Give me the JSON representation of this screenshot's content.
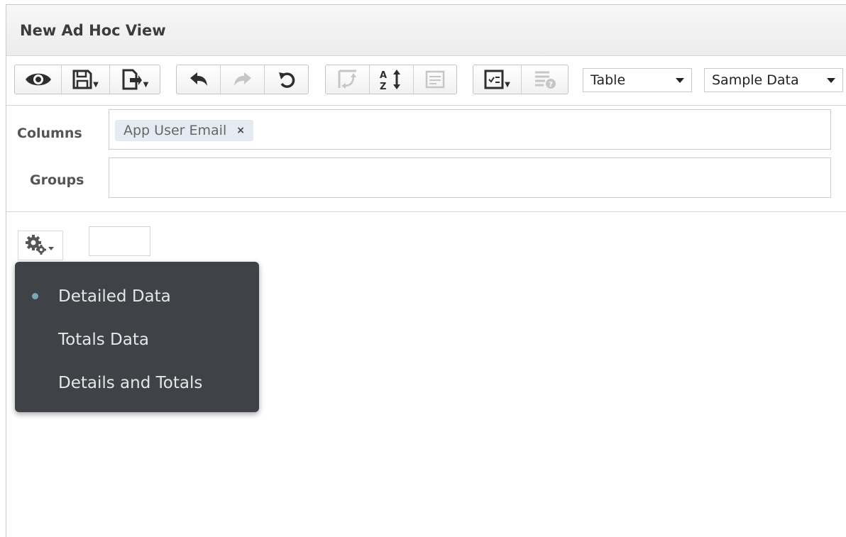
{
  "window": {
    "title": "New Ad Hoc View"
  },
  "toolbar": {
    "view_type": "Table",
    "data_mode": "Sample Data",
    "buttons": {
      "preview": "eye-icon",
      "save": "save-icon",
      "export": "export-icon",
      "undo": "undo-icon",
      "redo": "redo-icon",
      "undo_all": "undo-all-icon",
      "switch_groups": "pivot-icon",
      "sort": "sort-icon",
      "input_controls": "input-controls-icon",
      "display_options": "checklist-icon",
      "filters": "filter-icon"
    }
  },
  "fields": {
    "columns_label": "Columns",
    "groups_label": "Groups",
    "columns": [
      {
        "label": "App User Email",
        "remove": "×"
      }
    ]
  },
  "data_menu": {
    "items": [
      {
        "label": "Detailed Data",
        "selected": true
      },
      {
        "label": "Totals Data",
        "selected": false
      },
      {
        "label": "Details and Totals",
        "selected": false
      }
    ]
  },
  "colors": {
    "accent_dot": "#7fa4bd",
    "menu_bg": "#3f4347",
    "chip_bg": "#e5ebf3"
  }
}
